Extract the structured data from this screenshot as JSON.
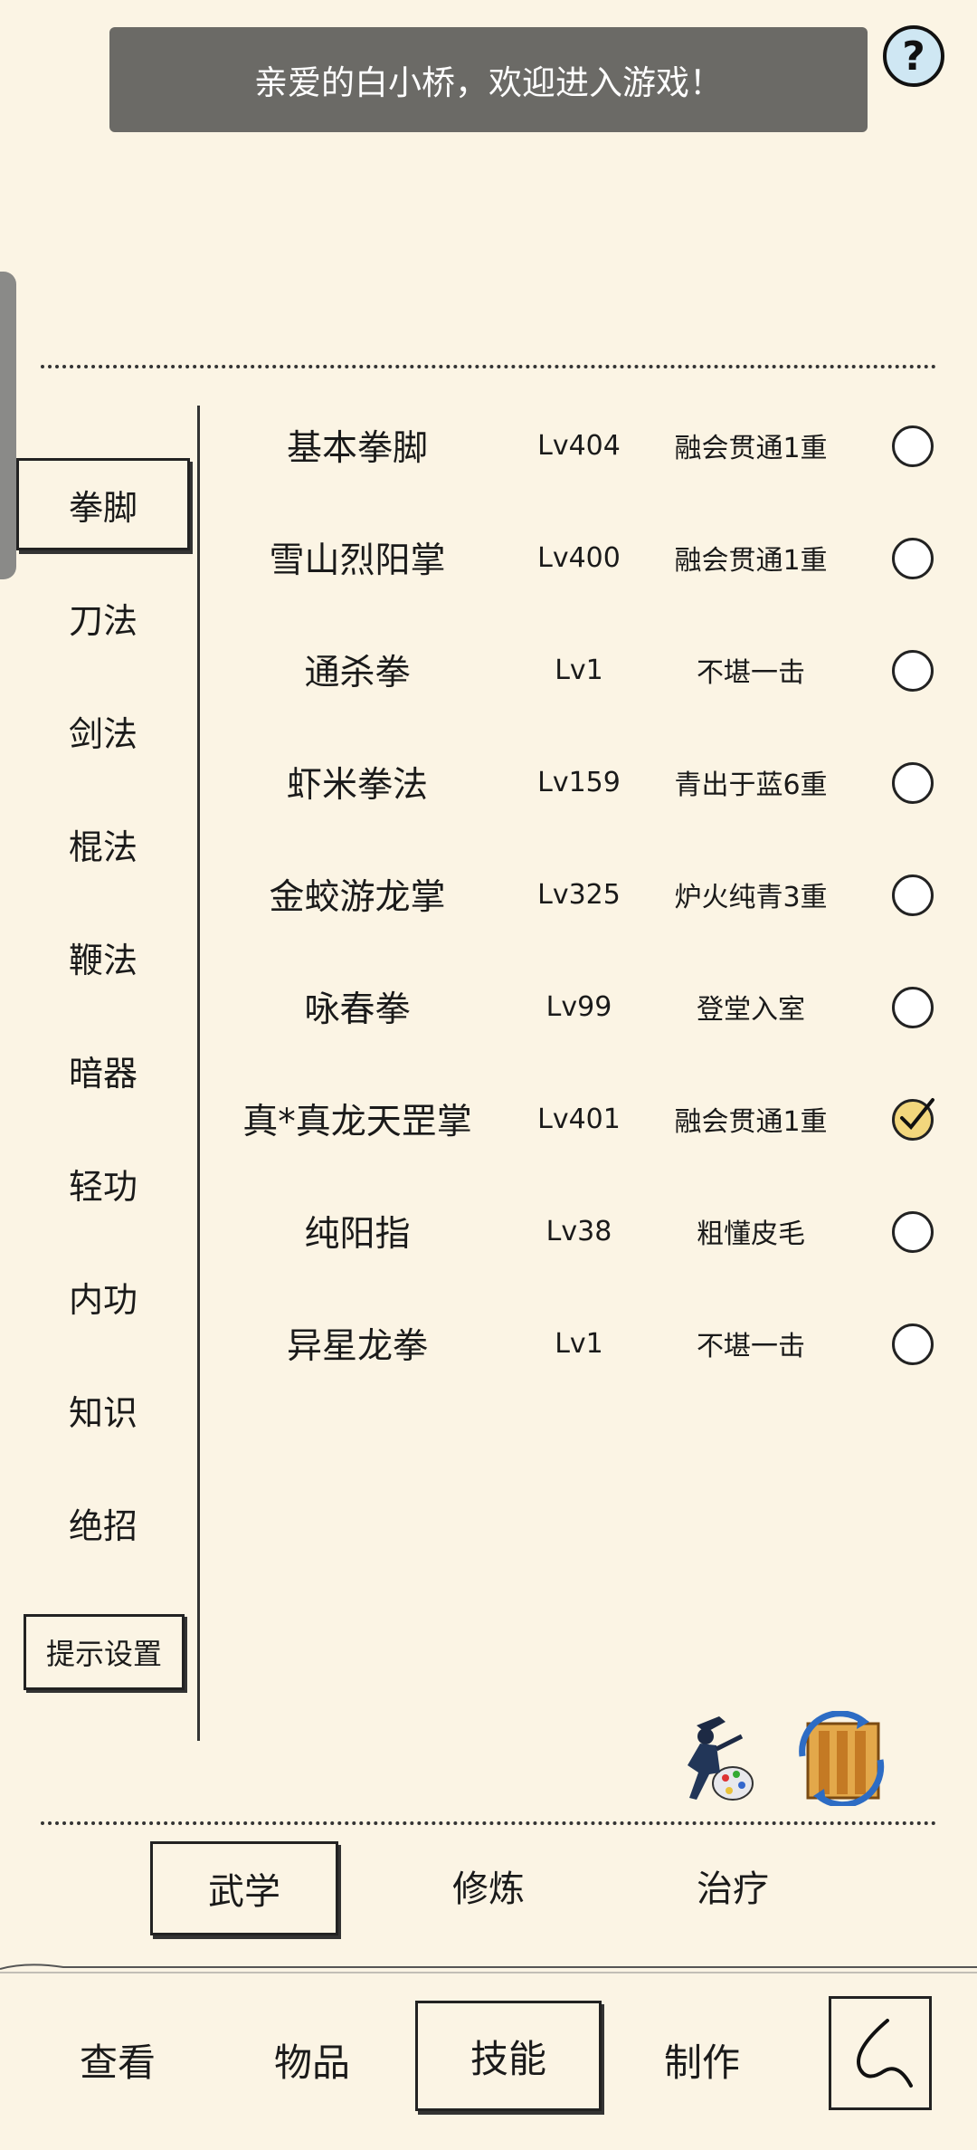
{
  "banner": {
    "message": "亲爱的白小桥，欢迎进入游戏！"
  },
  "help": {
    "label": "?"
  },
  "categories": [
    {
      "label": "拳脚",
      "active": true
    },
    {
      "label": "刀法"
    },
    {
      "label": "剑法"
    },
    {
      "label": "棍法"
    },
    {
      "label": "鞭法"
    },
    {
      "label": "暗器"
    },
    {
      "label": "轻功"
    },
    {
      "label": "内功"
    },
    {
      "label": "知识"
    },
    {
      "label": "绝招"
    }
  ],
  "tips_button": "提示设置",
  "skills": [
    {
      "name": "基本拳脚",
      "level": "Lv404",
      "stage": "融会贯通1重",
      "equipped": false
    },
    {
      "name": "雪山烈阳掌",
      "level": "Lv400",
      "stage": "融会贯通1重",
      "equipped": false
    },
    {
      "name": "通杀拳",
      "level": "Lv1",
      "stage": "不堪一击",
      "equipped": false
    },
    {
      "name": "虾米拳法",
      "level": "Lv159",
      "stage": "青出于蓝6重",
      "equipped": false
    },
    {
      "name": "金蛟游龙掌",
      "level": "Lv325",
      "stage": "炉火纯青3重",
      "equipped": false
    },
    {
      "name": "咏春拳",
      "level": "Lv99",
      "stage": "登堂入室",
      "equipped": false
    },
    {
      "name": "真*真龙天罡掌",
      "level": "Lv401",
      "stage": "融会贯通1重",
      "equipped": true
    },
    {
      "name": "纯阳指",
      "level": "Lv38",
      "stage": "粗懂皮毛",
      "equipped": false
    },
    {
      "name": "异星龙拳",
      "level": "Lv1",
      "stage": "不堪一击",
      "equipped": false
    }
  ],
  "action_icons": [
    "ninja-palette-icon",
    "book-refresh-icon"
  ],
  "subtabs": [
    {
      "label": "武学",
      "active": true
    },
    {
      "label": "修炼"
    },
    {
      "label": "治疗"
    }
  ],
  "bottom_nav": [
    {
      "label": "查看"
    },
    {
      "label": "物品"
    },
    {
      "label": "技能",
      "active": true
    },
    {
      "label": "制作"
    }
  ],
  "back_icon": "back-arrow-icon",
  "colors": {
    "background": "#fbf4e4",
    "banner": "#6b6a66",
    "check_fill": "#f3d77d"
  }
}
